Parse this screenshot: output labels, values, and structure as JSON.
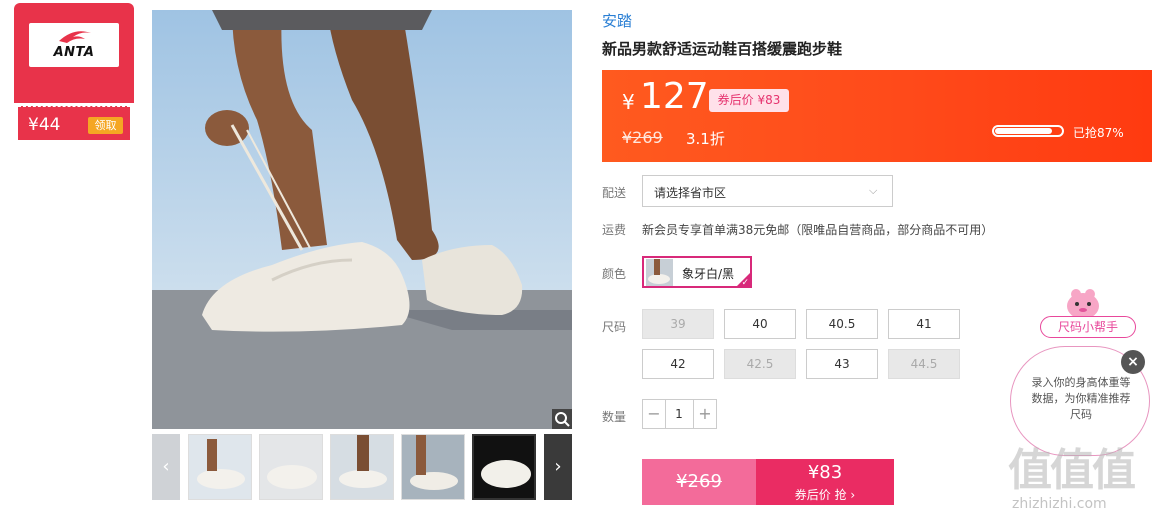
{
  "coupon": {
    "brand_logo": "ANTA",
    "amount": "¥44",
    "claim_label": "领取"
  },
  "product": {
    "brand": "安踏",
    "title": "新品男款舒适运动鞋百搭缓震跑步鞋"
  },
  "price": {
    "currency": "¥",
    "current": "127",
    "after_coupon_label": "券后价 ¥83",
    "original": "¥269",
    "discount": "3.1折",
    "sold_label": "已抢87%",
    "sold_percent": 87
  },
  "delivery": {
    "label": "配送",
    "placeholder": "请选择省市区"
  },
  "shipping": {
    "label": "运费",
    "text": "新会员专享首单满38元免邮（限唯品自营商品，部分商品不可用）"
  },
  "color": {
    "label": "颜色",
    "selected": "象牙白/黑"
  },
  "sizes": {
    "label": "尺码",
    "options": [
      {
        "value": "39",
        "available": false
      },
      {
        "value": "40",
        "available": true
      },
      {
        "value": "40.5",
        "available": true
      },
      {
        "value": "41",
        "available": true
      },
      {
        "value": "42",
        "available": true
      },
      {
        "value": "42.5",
        "available": false
      },
      {
        "value": "43",
        "available": true
      },
      {
        "value": "44.5",
        "available": false
      }
    ]
  },
  "quantity": {
    "label": "数量",
    "value": "1",
    "minus": "−",
    "plus": "+"
  },
  "buy": {
    "original_price": "¥269",
    "coupon_price": "¥83",
    "coupon_label": "券后价 抢 ›"
  },
  "size_helper": {
    "button_label": "尺码小帮手",
    "bubble_text": "录入你的身高体重等数据，为你精准推荐尺码",
    "close": "×"
  },
  "watermark": {
    "mark": "值值值",
    "url": "zhizhizhi.com"
  },
  "gallery": {
    "prev": "‹",
    "next": "›"
  },
  "colors": {
    "accent_orange": "#ff4a1a",
    "accent_pink": "#ea2c63",
    "brand_blue": "#2a7fd4"
  }
}
